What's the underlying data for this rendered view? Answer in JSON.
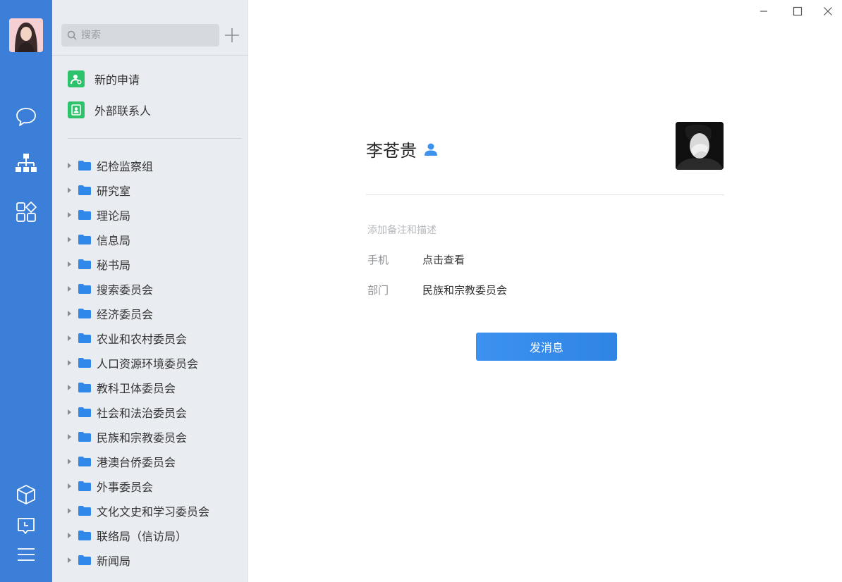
{
  "search": {
    "placeholder": "搜索"
  },
  "special_items": [
    {
      "label": "新的申请",
      "icon": "new-request-icon"
    },
    {
      "label": "外部联系人",
      "icon": "external-contact-icon"
    }
  ],
  "departments": [
    "纪检监察组",
    "研究室",
    "理论局",
    "信息局",
    "秘书局",
    "搜索委员会",
    "经济委员会",
    "农业和农村委员会",
    "人口资源环境委员会",
    "教科卫体委员会",
    "社会和法治委员会",
    "民族和宗教委员会",
    "港澳台侨委员会",
    "外事委员会",
    "文化文史和学习委员会",
    "联络局（信访局）",
    "新闻局"
  ],
  "profile": {
    "name": "李苍贵",
    "remark_placeholder": "添加备注和描述",
    "phone_label": "手机",
    "phone_value": "点击查看",
    "dept_label": "部门",
    "dept_value": "民族和宗教委员会",
    "send_button": "发消息"
  },
  "colors": {
    "rail": "#3b7fd9",
    "accent": "#2f88ea",
    "special_icon": "#2dc26b",
    "folder": "#2f88ea"
  }
}
